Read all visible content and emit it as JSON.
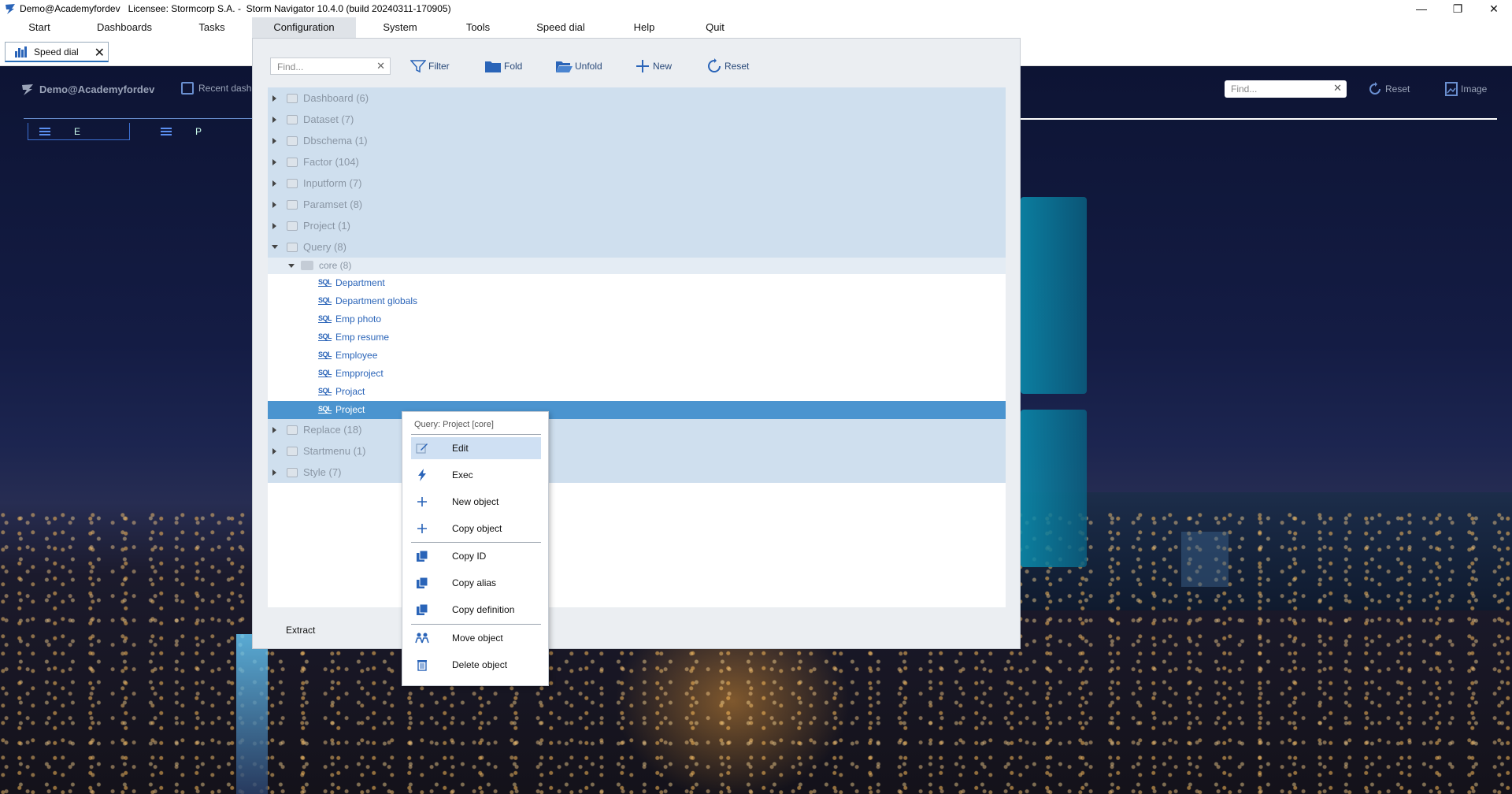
{
  "window": {
    "title": "Demo@Academyfordev   Licensee: Stormcorp S.A. -  Storm Navigator 10.4.0 (build 20240311-170905)"
  },
  "menubar": {
    "items": [
      "Start",
      "Dashboards",
      "Tasks",
      "Configuration",
      "System",
      "Tools",
      "Speed dial",
      "Help",
      "Quit"
    ],
    "active": "Configuration"
  },
  "tabs": [
    {
      "label": "Speed dial"
    }
  ],
  "dashboard": {
    "user": "Demo@Academyfordev",
    "recent": "Recent dashb",
    "find_placeholder": "Find...",
    "reset_label": "Reset",
    "image_label": "Image",
    "tab_e": "E",
    "tab_p": "P"
  },
  "config": {
    "find_placeholder": "Find...",
    "toolbar": {
      "filter": "Filter",
      "fold": "Fold",
      "unfold": "Unfold",
      "new": "New",
      "reset": "Reset"
    },
    "tree": [
      {
        "label": "Dashboard (6)"
      },
      {
        "label": "Dataset (7)"
      },
      {
        "label": "Dbschema (1)"
      },
      {
        "label": "Factor (104)"
      },
      {
        "label": "Inputform (7)"
      },
      {
        "label": "Paramset (8)"
      },
      {
        "label": "Project (1)"
      },
      {
        "label": "Query (8)"
      }
    ],
    "query_folder": "core (8)",
    "query_items": [
      "Department",
      "Department globals",
      "Emp photo",
      "Emp resume",
      "Employee",
      "Empproject",
      "Projact",
      "Project"
    ],
    "sql_tag": "SQL",
    "tree_after": [
      {
        "label": "Replace (18)"
      },
      {
        "label": "Startmenu (1)"
      },
      {
        "label": "Style (7)"
      }
    ],
    "extract": "Extract"
  },
  "context_menu": {
    "header": "Query: Project [core]",
    "items": [
      {
        "label": "Edit",
        "icon": "edit-icon"
      },
      {
        "label": "Exec",
        "icon": "lightning-icon"
      },
      {
        "label": "New object",
        "icon": "plus-icon"
      },
      {
        "label": "Copy object",
        "icon": "plus-icon"
      },
      {
        "label": "Copy ID",
        "icon": "copy-icon"
      },
      {
        "label": "Copy alias",
        "icon": "copy-icon"
      },
      {
        "label": "Copy definition",
        "icon": "copy-icon"
      },
      {
        "label": "Move object",
        "icon": "move-icon"
      },
      {
        "label": "Delete object",
        "icon": "trash-icon"
      }
    ]
  }
}
